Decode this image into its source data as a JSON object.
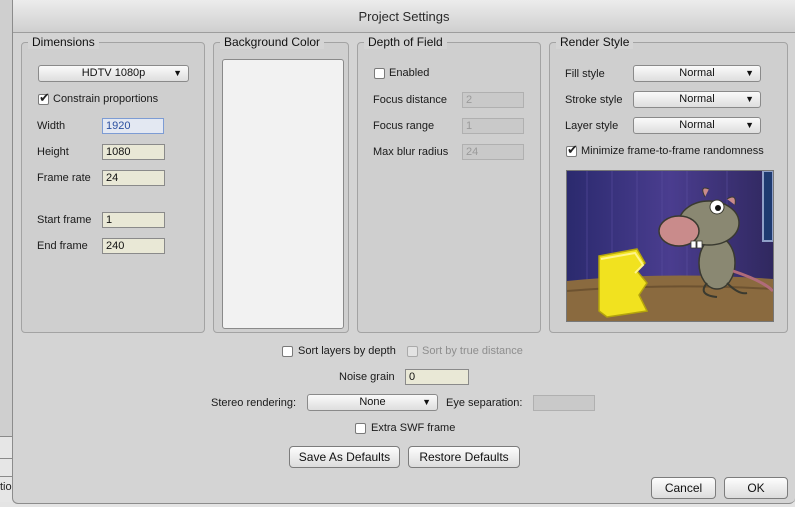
{
  "window": {
    "title": "Project Settings"
  },
  "dimensions": {
    "legend": "Dimensions",
    "preset": "HDTV 1080p",
    "constrain_label": "Constrain proportions",
    "constrain_checked": true,
    "width_label": "Width",
    "width_value": "1920",
    "height_label": "Height",
    "height_value": "1080",
    "frame_rate_label": "Frame rate",
    "frame_rate_value": "24",
    "start_frame_label": "Start frame",
    "start_frame_value": "1",
    "end_frame_label": "End frame",
    "end_frame_value": "240"
  },
  "background": {
    "legend": "Background Color",
    "color": "#f2f2f2"
  },
  "dof": {
    "legend": "Depth of Field",
    "enabled_label": "Enabled",
    "focus_distance_label": "Focus distance",
    "focus_distance_value": "2",
    "focus_range_label": "Focus range",
    "focus_range_value": "1",
    "max_blur_label": "Max blur radius",
    "max_blur_value": "24"
  },
  "render_style": {
    "legend": "Render Style",
    "fill_label": "Fill style",
    "fill_value": "Normal",
    "stroke_label": "Stroke style",
    "stroke_value": "Normal",
    "layer_label": "Layer style",
    "layer_value": "Normal",
    "minimize_label": "Minimize frame-to-frame randomness",
    "minimize_checked": true
  },
  "general": {
    "sort_layers_label": "Sort layers by depth",
    "sort_true_label": "Sort by true distance",
    "noise_label": "Noise grain",
    "noise_value": "0",
    "stereo_label": "Stereo rendering:",
    "stereo_value": "None",
    "eye_sep_label": "Eye separation:",
    "eye_sep_value": "",
    "extra_swf_label": "Extra SWF frame"
  },
  "buttons": {
    "save_defaults": "Save As Defaults",
    "restore_defaults": "Restore Defaults",
    "cancel": "Cancel",
    "ok": "OK"
  },
  "backdrop": {
    "fragment": "tio"
  }
}
